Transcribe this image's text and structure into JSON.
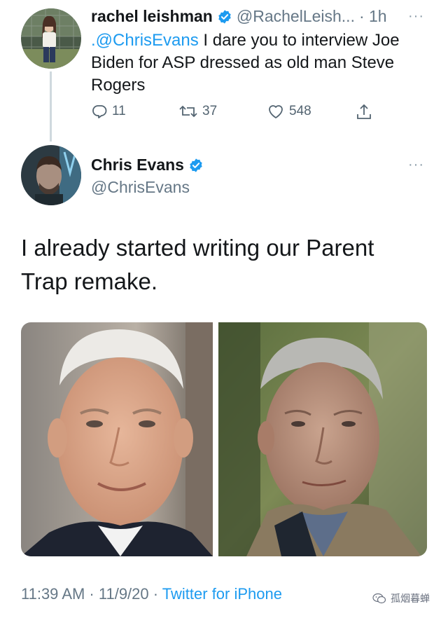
{
  "reply_tweet": {
    "display_name": "rachel leishman",
    "handle": "@RachelLeish...",
    "time": "· 1h",
    "mention": ".@ChrisEvans",
    "text": " I dare you to interview Joe Biden for ASP dressed as old man Steve Rogers",
    "actions": {
      "replies": "11",
      "retweets": "37",
      "likes": "548"
    },
    "more": "···"
  },
  "main_tweet": {
    "display_name": "Chris Evans",
    "handle": "@ChrisEvans",
    "more": "···",
    "text": "I already started writing our Parent Trap remake.",
    "timestamp": "11:39 AM · 11/9/20 · ",
    "source": "Twitter for iPhone"
  },
  "watermark": {
    "text": "孤烟暮蝉"
  },
  "colors": {
    "link": "#1d9bf0",
    "verified": "#1d9bf0",
    "secondary_text": "#657786"
  }
}
